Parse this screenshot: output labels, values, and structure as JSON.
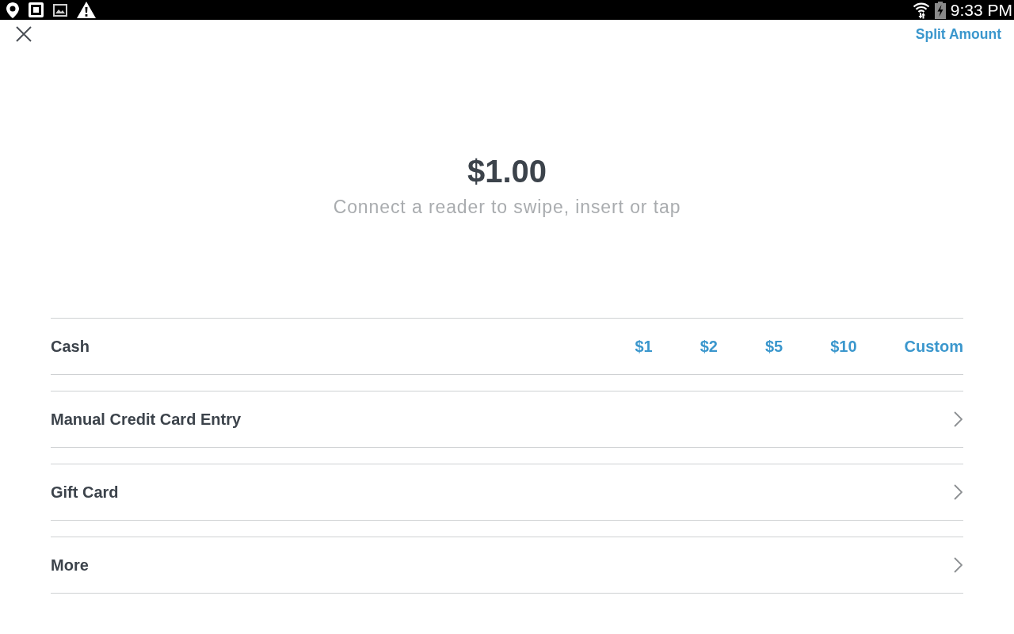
{
  "status_bar": {
    "time": "9:33 PM"
  },
  "header": {
    "action": "Split Amount"
  },
  "amount": "$1.00",
  "prompt": "Connect a reader to swipe, insert or tap",
  "payment_options": [
    {
      "kind": "cash",
      "label": "Cash",
      "amounts": [
        "$1",
        "$2",
        "$5",
        "$10",
        "Custom"
      ]
    },
    {
      "kind": "link",
      "label": "Manual Credit Card Entry"
    },
    {
      "kind": "link",
      "label": "Gift Card"
    },
    {
      "kind": "link",
      "label": "More"
    }
  ]
}
